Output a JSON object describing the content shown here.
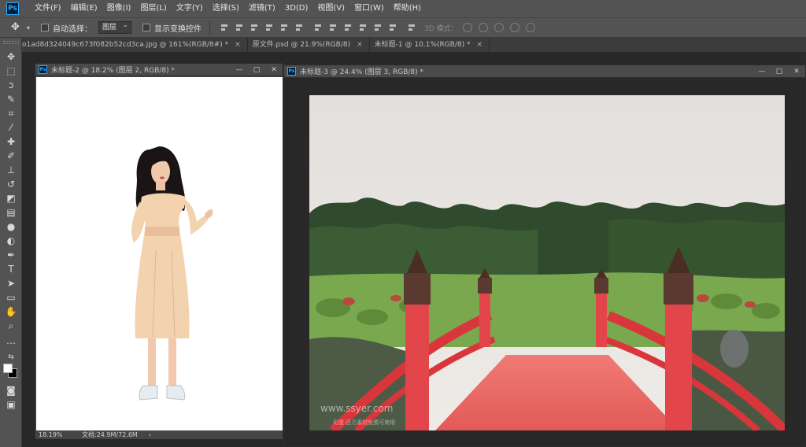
{
  "app": {
    "logo_text": "Ps"
  },
  "menu": [
    "文件(F)",
    "编辑(E)",
    "图像(I)",
    "图层(L)",
    "文字(Y)",
    "选择(S)",
    "滤镜(T)",
    "3D(D)",
    "视图(V)",
    "窗口(W)",
    "帮助(H)"
  ],
  "options": {
    "auto_select_label": "自动选择：",
    "auto_select_value": "图层",
    "show_transform_label": "显示变换控件",
    "mode_3d_label": "3D 模式："
  },
  "tabs": [
    {
      "label": "o1ad8d324049c673f082b52cd3ca.jpg @ 161%(RGB/8#) *"
    },
    {
      "label": "原文件.psd @ 21.9%(RGB/8)"
    },
    {
      "label": "未标题-1 @ 10.1%(RGB/8) *"
    }
  ],
  "tab_close": "×",
  "window_left": {
    "title": "未标题-2 @ 18.2% (图层 2, RGB/8) *",
    "zoom": "18.19%",
    "doc_info": "文档:24.9M/72.6M",
    "arrow": "›"
  },
  "window_right": {
    "title": "未标题-3 @ 24.4% (图层 3, RGB/8) *",
    "watermark": "www.ssyer.com",
    "watermark_sub": "彩蛋·百万素材免费可商用"
  },
  "win_controls": {
    "min": "—",
    "max": "□",
    "close": "✕"
  },
  "colors": {
    "sky": "#e6e3df",
    "grass": "#7aa84f",
    "bridge": "#e3464a",
    "deck": "#e86a67",
    "post_cap": "#5a3a30",
    "dress": "#f3d2b0",
    "hair": "#1a1414"
  }
}
